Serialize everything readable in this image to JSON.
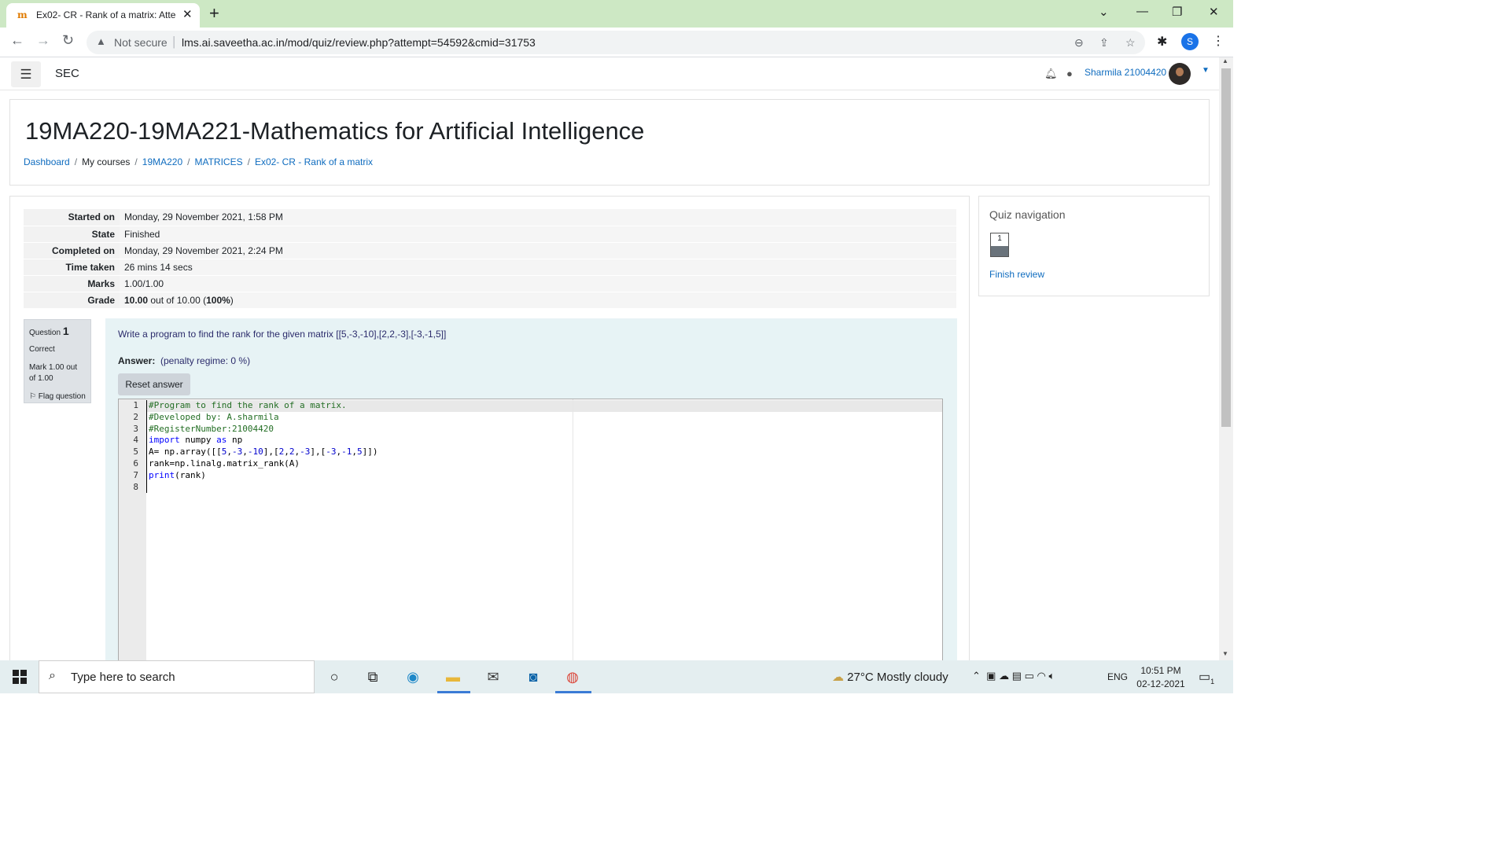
{
  "browser": {
    "tab_title": "Ex02- CR - Rank of a matrix: Atte",
    "favicon_text": "m",
    "not_secure": "Not secure",
    "url": "lms.ai.saveetha.ac.in/mod/quiz/review.php?attempt=54592&cmid=31753",
    "profile_initial": "S"
  },
  "header": {
    "site_name": "SEC",
    "user_name": "Sharmila 21004420 ("
  },
  "page": {
    "course_title": "19MA220-19MA221-Mathematics for Artificial Intelligence",
    "breadcrumb": [
      "Dashboard",
      "My courses",
      "19MA220",
      "MATRICES",
      "Ex02- CR - Rank of a matrix"
    ]
  },
  "summary": {
    "rows": [
      {
        "label": "Started on",
        "value": "Monday, 29 November 2021, 1:58 PM"
      },
      {
        "label": "State",
        "value": "Finished"
      },
      {
        "label": "Completed on",
        "value": "Monday, 29 November 2021, 2:24 PM"
      },
      {
        "label": "Time taken",
        "value": "26 mins 14 secs"
      },
      {
        "label": "Marks",
        "value": "1.00/1.00"
      }
    ],
    "grade_label": "Grade",
    "grade_value": "10.00",
    "grade_mid": " out of 10.00 (",
    "grade_pct": "100%",
    "grade_end": ")"
  },
  "question": {
    "label": "Question",
    "number": "1",
    "status": "Correct",
    "mark_text": "Mark 1.00 out of 1.00",
    "flag_text": "Flag question",
    "text": "Write a program to find the rank for the given matrix [[5,-3,-10],[2,2,-3],[-3,-1,5]]",
    "answer_label": "Answer:",
    "penalty": "(penalty regime: 0 %)",
    "reset_label": "Reset answer"
  },
  "code": {
    "line_numbers": [
      "1",
      "2",
      "3",
      "4",
      "5",
      "6",
      "7",
      "8"
    ]
  },
  "quiz_nav": {
    "title": "Quiz navigation",
    "button_number": "1",
    "finish_label": "Finish review"
  },
  "taskbar": {
    "search_placeholder": "Type here to search",
    "temperature": "27°C",
    "weather": "Mostly cloudy",
    "language": "ENG",
    "time": "10:51 PM",
    "date": "02-12-2021",
    "notification_count": "1"
  }
}
